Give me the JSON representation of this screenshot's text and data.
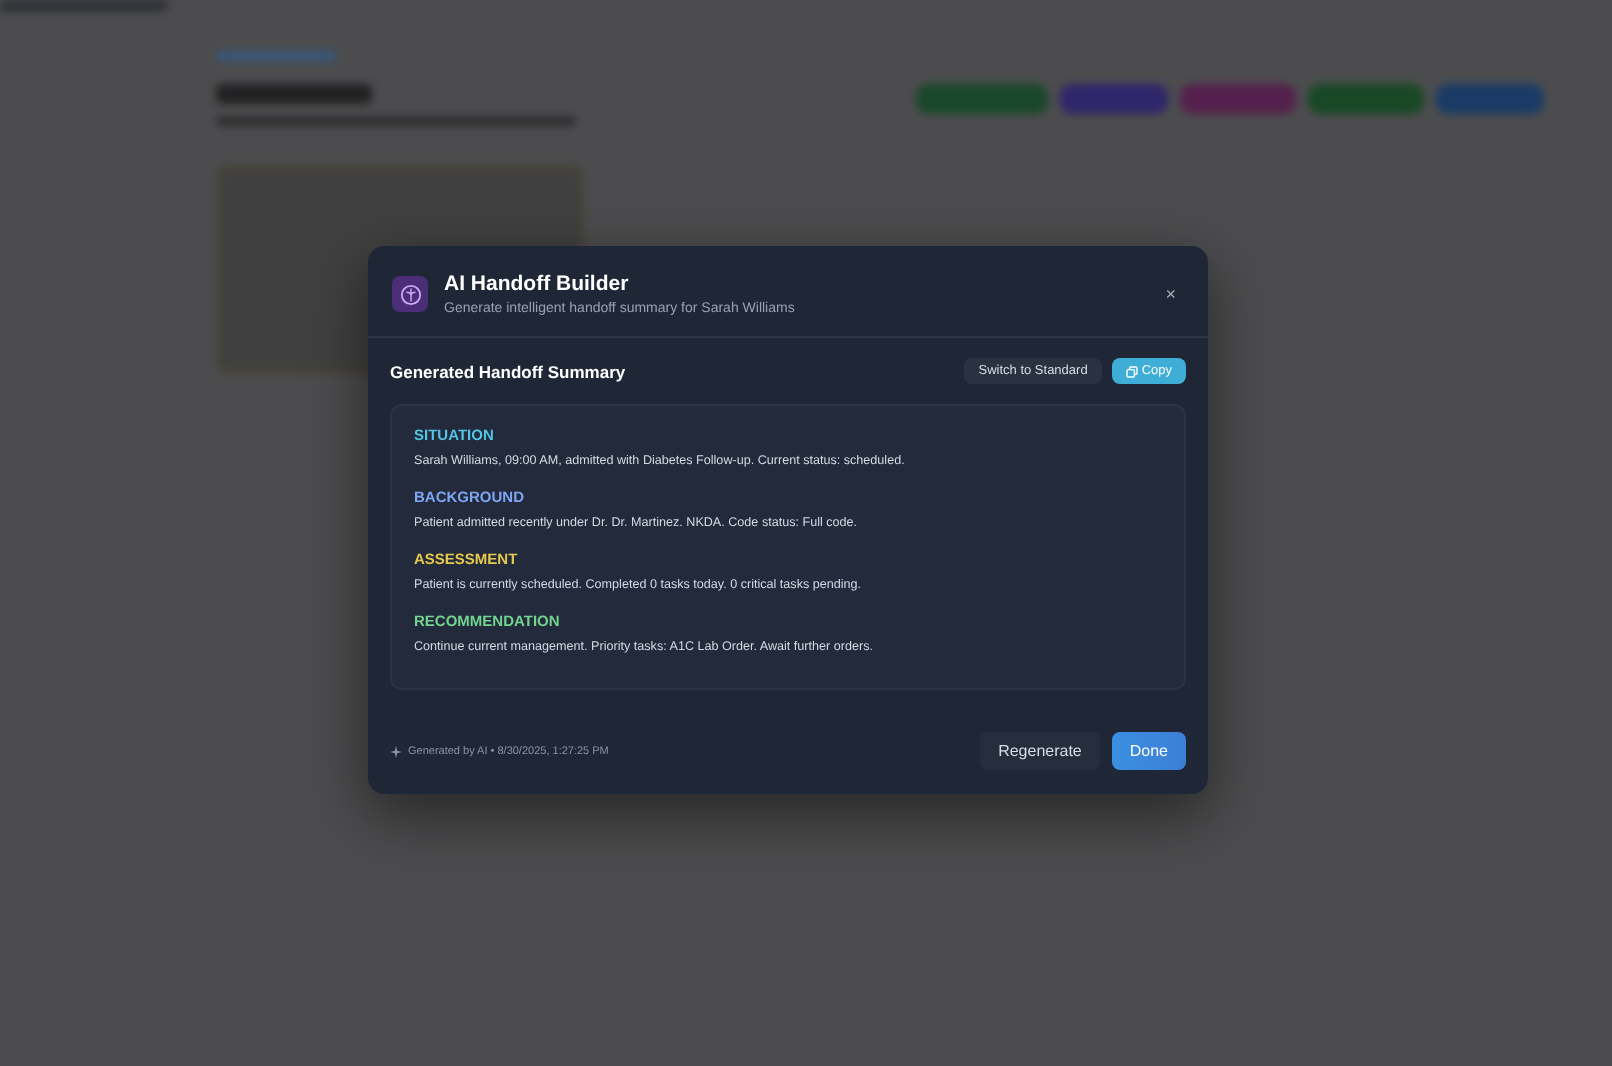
{
  "dialog": {
    "title": "AI Handoff Builder",
    "subtitle": "Generate intelligent handoff summary for Sarah Williams",
    "close": "×"
  },
  "summary": {
    "title": "Generated Handoff Summary",
    "buttons": [
      {
        "kind": "secondary",
        "label": "Switch to Standard"
      },
      {
        "kind": "copy",
        "label": "Copy"
      }
    ],
    "sections": [
      {
        "kind": "situation",
        "heading": "SITUATION",
        "text": "Sarah Williams, 09:00 AM, admitted with Diabetes Follow-up. Current status: scheduled."
      },
      {
        "kind": "background",
        "heading": "BACKGROUND",
        "text": "Patient admitted recently under Dr. Dr. Martinez. NKDA. Code status: Full code."
      },
      {
        "kind": "assessment",
        "heading": "ASSESSMENT",
        "text": "Patient is currently scheduled. Completed 0 tasks today. 0 critical tasks pending."
      },
      {
        "kind": "recommendation",
        "heading": "RECOMMENDATION",
        "text": "Continue current management. Priority tasks: A1C Lab Order. Await further orders."
      }
    ]
  },
  "footer": {
    "note": "Generated by AI • 8/30/2025, 1:27:25 PM",
    "actions": [
      {
        "kind": "secondary",
        "label": "Regenerate"
      },
      {
        "kind": "primary",
        "label": "Done"
      }
    ]
  }
}
